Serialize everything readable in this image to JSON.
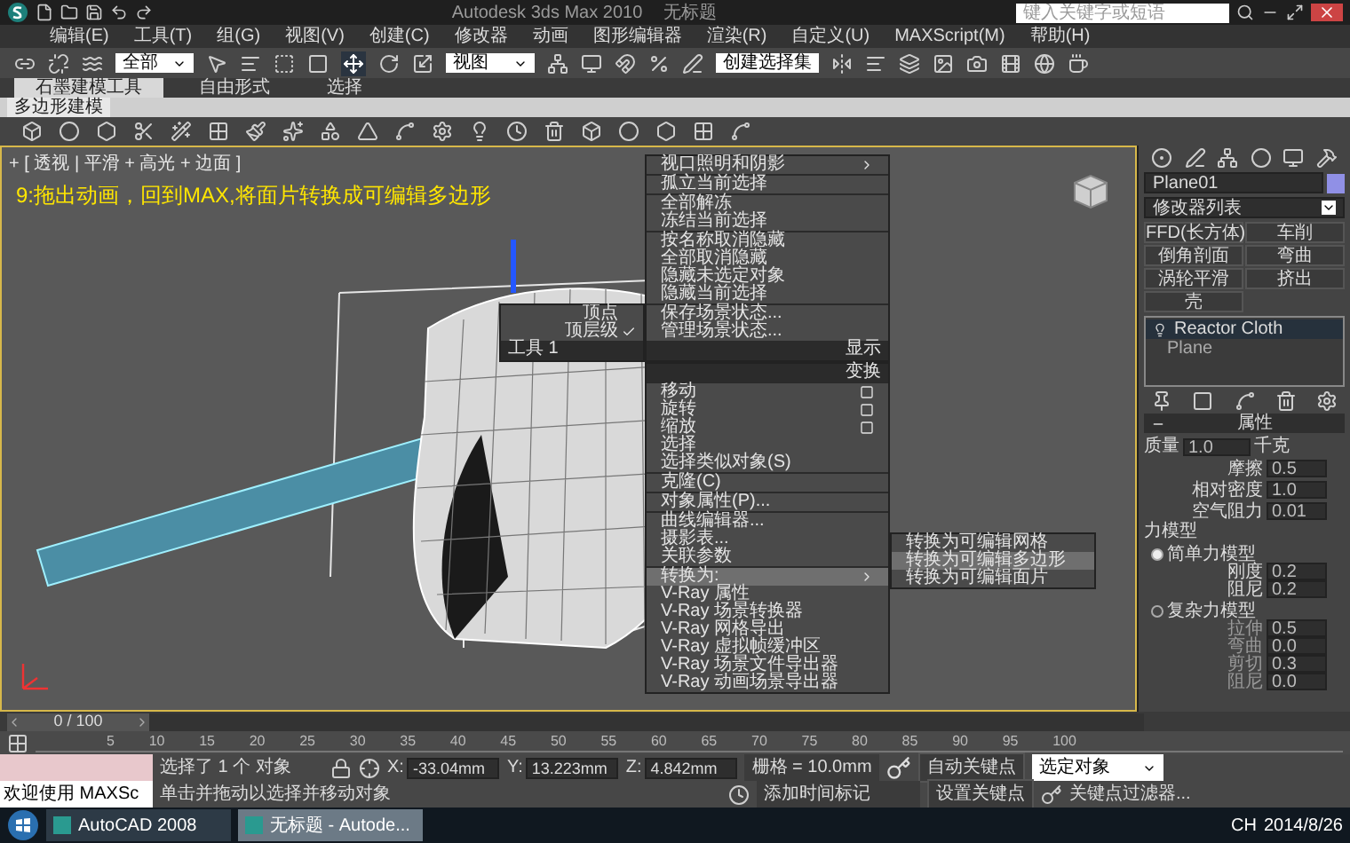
{
  "title_bar": {
    "title": "Autodesk 3ds Max  2010",
    "document": "无标题",
    "search": {
      "placeholder": "键入关键字或短语"
    }
  },
  "menu_bar": [
    "编辑(E)",
    "工具(T)",
    "组(G)",
    "视图(V)",
    "创建(C)",
    "修改器",
    "动画",
    "图形编辑器",
    "渲染(R)",
    "自定义(U)",
    "MAXScript(M)",
    "帮助(H)"
  ],
  "main_toolbar": {
    "selection_filter": "全部",
    "reference_coordinate": "视图",
    "named_selection": "创建选择集"
  },
  "ribbon": {
    "tabs": [
      {
        "label": "石墨建模工具",
        "selected": true
      },
      {
        "label": "自由形式",
        "selected": false
      },
      {
        "label": "选择",
        "selected": false
      }
    ],
    "panel": "多边形建模"
  },
  "viewport": {
    "label": "+ [ 透视 | 平滑 + 高光 + 边面 ]",
    "caption": "9:拖出动画，回到MAX,将面片转换成可编辑多边形",
    "quad_menu": {
      "left_items": [
        {
          "label": "顶点",
          "checked": false
        },
        {
          "label": "顶层级",
          "checked": true
        }
      ],
      "left_header": "工具 1",
      "display_header": "显示",
      "display_groups": [
        [
          {
            "label": "视口照明和阴影",
            "submenu": true
          }
        ],
        [
          {
            "label": "孤立当前选择",
            "submenu": false
          }
        ],
        [
          {
            "label": "全部解冻",
            "submenu": false
          },
          {
            "label": "冻结当前选择",
            "submenu": false
          }
        ],
        [
          {
            "label": "按名称取消隐藏",
            "submenu": false
          },
          {
            "label": "全部取消隐藏",
            "submenu": false
          },
          {
            "label": "隐藏未选定对象",
            "submenu": false
          },
          {
            "label": "隐藏当前选择",
            "submenu": false
          }
        ],
        [
          {
            "label": "保存场景状态...",
            "submenu": false
          },
          {
            "label": "管理场景状态...",
            "submenu": false
          }
        ]
      ],
      "transform_header": "变换",
      "transform_groups": [
        [
          {
            "label": "移动",
            "submenu": false,
            "options": true,
            "selected": false
          },
          {
            "label": "旋转",
            "submenu": false,
            "options": true,
            "selected": false
          },
          {
            "label": "缩放",
            "submenu": false,
            "options": true,
            "selected": false
          },
          {
            "label": "选择",
            "submenu": false,
            "options": false,
            "selected": false
          },
          {
            "label": "选择类似对象(S)",
            "submenu": false,
            "options": false,
            "selected": false
          }
        ],
        [
          {
            "label": "克隆(C)",
            "submenu": false,
            "options": false,
            "selected": false
          }
        ],
        [
          {
            "label": "对象属性(P)...",
            "submenu": false,
            "options": false,
            "selected": false
          }
        ],
        [
          {
            "label": "曲线编辑器...",
            "submenu": false,
            "options": false,
            "selected": false
          },
          {
            "label": "摄影表...",
            "submenu": false,
            "options": false,
            "selected": false
          },
          {
            "label": "关联参数",
            "submenu": false,
            "options": false,
            "selected": false
          }
        ],
        [
          {
            "label": "转换为:",
            "submenu": true,
            "options": false,
            "selected": true
          },
          {
            "label": "V-Ray 属性",
            "submenu": false,
            "options": false,
            "selected": false
          },
          {
            "label": "V-Ray 场景转换器",
            "submenu": false,
            "options": false,
            "selected": false
          },
          {
            "label": "V-Ray 网格导出",
            "submenu": false,
            "options": false,
            "selected": false
          },
          {
            "label": "V-Ray 虚拟帧缓冲区",
            "submenu": false,
            "options": false,
            "selected": false
          },
          {
            "label": "V-Ray 场景文件导出器",
            "submenu": false,
            "options": false,
            "selected": false
          },
          {
            "label": "V-Ray 动画场景导出器",
            "submenu": false,
            "options": false,
            "selected": false
          }
        ]
      ],
      "submenu": [
        {
          "label": "转换为可编辑网格",
          "selected": false
        },
        {
          "label": "转换为可编辑多边形",
          "selected": true
        },
        {
          "label": "转换为可编辑面片",
          "selected": false
        }
      ]
    }
  },
  "command_panel": {
    "object_name": "Plane01",
    "modifier_list": "修改器列表",
    "modifier_buttons": [
      "FFD(长方体)",
      "车削",
      "倒角剖面",
      "弯曲",
      "涡轮平滑",
      "挤出",
      "壳"
    ],
    "stack": [
      {
        "label": "Reactor Cloth",
        "selected": true
      },
      {
        "label": "Plane",
        "selected": false
      }
    ],
    "rollout": {
      "title": "属性",
      "mass": {
        "label": "质量",
        "value": "1.0",
        "unit": "千克"
      },
      "params": [
        {
          "label": "摩擦",
          "value": "0.5"
        },
        {
          "label": "相对密度",
          "value": "1.0"
        },
        {
          "label": "空气阻力",
          "value": "0.01"
        }
      ],
      "force_model": {
        "title": "力模型",
        "options": [
          {
            "label": "简单力模型",
            "selected": true,
            "params": [
              {
                "label": "刚度",
                "value": "0.2"
              },
              {
                "label": "阻尼",
                "value": "0.2"
              }
            ]
          },
          {
            "label": "复杂力模型",
            "selected": false,
            "params": [
              {
                "label": "拉伸",
                "value": "0.5"
              },
              {
                "label": "弯曲",
                "value": "0.0"
              },
              {
                "label": "剪切",
                "value": "0.3"
              },
              {
                "label": "阻尼",
                "value": "0.0"
              }
            ]
          }
        ]
      }
    }
  },
  "timeline": {
    "frame": "0 / 100",
    "level": 0,
    "ticks": [
      "5",
      "10",
      "15",
      "20",
      "25",
      "30",
      "35",
      "40",
      "45",
      "50",
      "55",
      "60",
      "65",
      "70",
      "75",
      "80",
      "85",
      "90",
      "95",
      "100"
    ]
  },
  "status_bar": {
    "maxscript": "欢迎使用 MAXSc",
    "selection": "选择了 1 个 对象",
    "prompt": "单击并拖动以选择并移动对象",
    "coordinates": [
      {
        "axis": "X:",
        "value": "-33.04mm"
      },
      {
        "axis": "Y:",
        "value": "13.223mm"
      },
      {
        "axis": "Z:",
        "value": "4.842mm"
      }
    ],
    "grid": "栅格 = 10.0mm",
    "add_time_tag": "添加时间标记",
    "auto_key": "自动关键点",
    "key_target": "选定对象",
    "set_key": "设置关键点",
    "key_filters": "关键点过滤器..."
  },
  "taskbar": {
    "apps": [
      {
        "label": "AutoCAD 2008",
        "selected": false
      },
      {
        "label": "无标题 - Autode...",
        "selected": true
      }
    ],
    "language": "CH",
    "date": "2014/8/26"
  }
}
